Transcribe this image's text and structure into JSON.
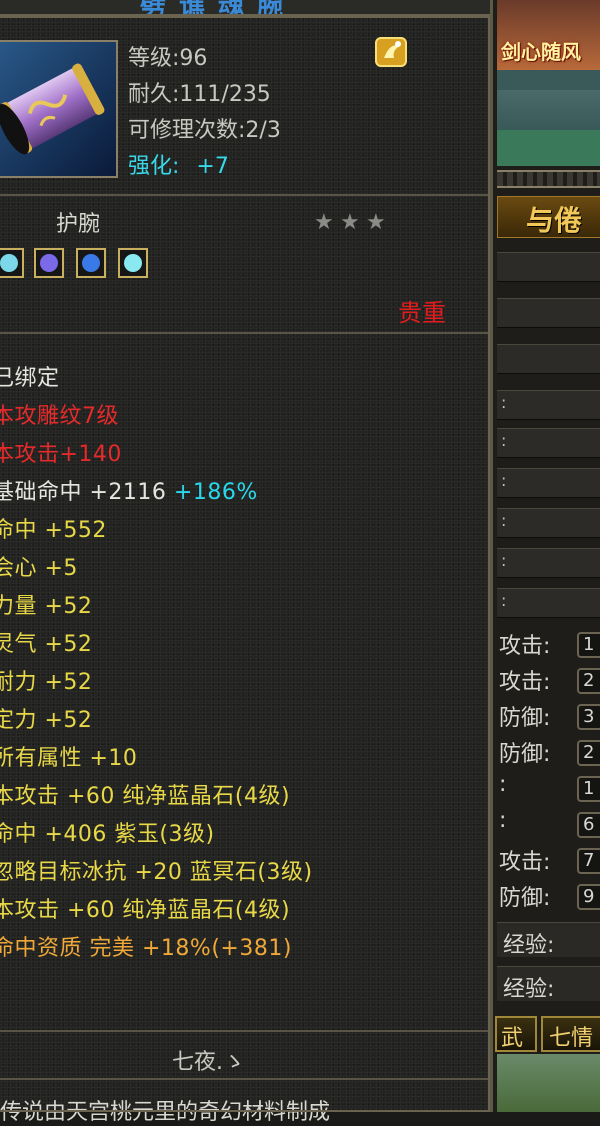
{
  "window": {
    "title": "劈 谯 魂 腕"
  },
  "item": {
    "level": "等级:96",
    "durability": "耐久:111/235",
    "repair": "可修理次数:2/3",
    "enhance_label": "强化:",
    "enhance_value": "+7",
    "name": "护腕",
    "stars": [
      "★",
      "★",
      "★"
    ],
    "rarity": "贵重",
    "gems": [
      {
        "icon": "cyan-gem-icon",
        "color": "#7ad8e8"
      },
      {
        "icon": "purple-gem-icon",
        "color": "#7a6ae8"
      },
      {
        "icon": "blue-gem-icon",
        "color": "#3a7ae8"
      },
      {
        "icon": "cyan-gem-icon",
        "color": "#8ae8f0"
      }
    ],
    "attributes": [
      {
        "text": "己绑定",
        "color": "white"
      },
      {
        "text": "本攻雕纹7级",
        "color": "red"
      },
      {
        "text": "本攻击+140",
        "color": "red"
      },
      {
        "text": "基础命中 +2116",
        "extra": "+186%",
        "color": "white"
      },
      {
        "text": "命中 +552",
        "color": "yellow"
      },
      {
        "text": "会心 +5",
        "color": "yellow"
      },
      {
        "text": "力量 +52",
        "color": "yellow"
      },
      {
        "text": "灵气 +52",
        "color": "yellow"
      },
      {
        "text": "耐力 +52",
        "color": "yellow"
      },
      {
        "text": "定力 +52",
        "color": "yellow"
      },
      {
        "text": "所有属性 +10",
        "color": "yellow"
      },
      {
        "text": "本攻击 +60 纯净蓝晶石(4级)",
        "color": "yellow"
      },
      {
        "text": "命中 +406 紫玉(3级)",
        "color": "yellow"
      },
      {
        "text": "忽略目标冰抗 +20 蓝冥石(3级)",
        "color": "yellow"
      },
      {
        "text": "本攻击 +60 纯净蓝晶石(4级)",
        "color": "yellow"
      },
      {
        "text": "命中资质  完美 +18%(+381)",
        "color": "orange"
      }
    ],
    "owner": "七夜.ゝ",
    "description": "传说由天宫桃元里的奇幻材料制成"
  },
  "right": {
    "banner_text": "剑心随风",
    "tab_title": "与倦",
    "rows": [
      ":",
      ":",
      ":",
      ":",
      ":",
      ":"
    ],
    "row_colon": ":",
    "stats": [
      {
        "label": "攻击:",
        "value": "1"
      },
      {
        "label": "攻击:",
        "value": "2"
      },
      {
        "label": "防御:",
        "value": "3"
      },
      {
        "label": "防御:",
        "value": "2"
      },
      {
        "label": ":",
        "value": "1"
      },
      {
        "label": ":",
        "value": "6"
      },
      {
        "label": "攻击:",
        "value": "7"
      },
      {
        "label": "防御:",
        "value": "9"
      }
    ],
    "exp1": "经验:",
    "exp2": "经验:",
    "tab_left": "武",
    "tab_right": "七情"
  },
  "colors": {
    "red": "#e42a2a",
    "yellow": "#e8d848",
    "orange": "#f0a838",
    "cyan": "#28d8ec",
    "white": "#e6e6e0",
    "rarity": "#e21c1c"
  }
}
